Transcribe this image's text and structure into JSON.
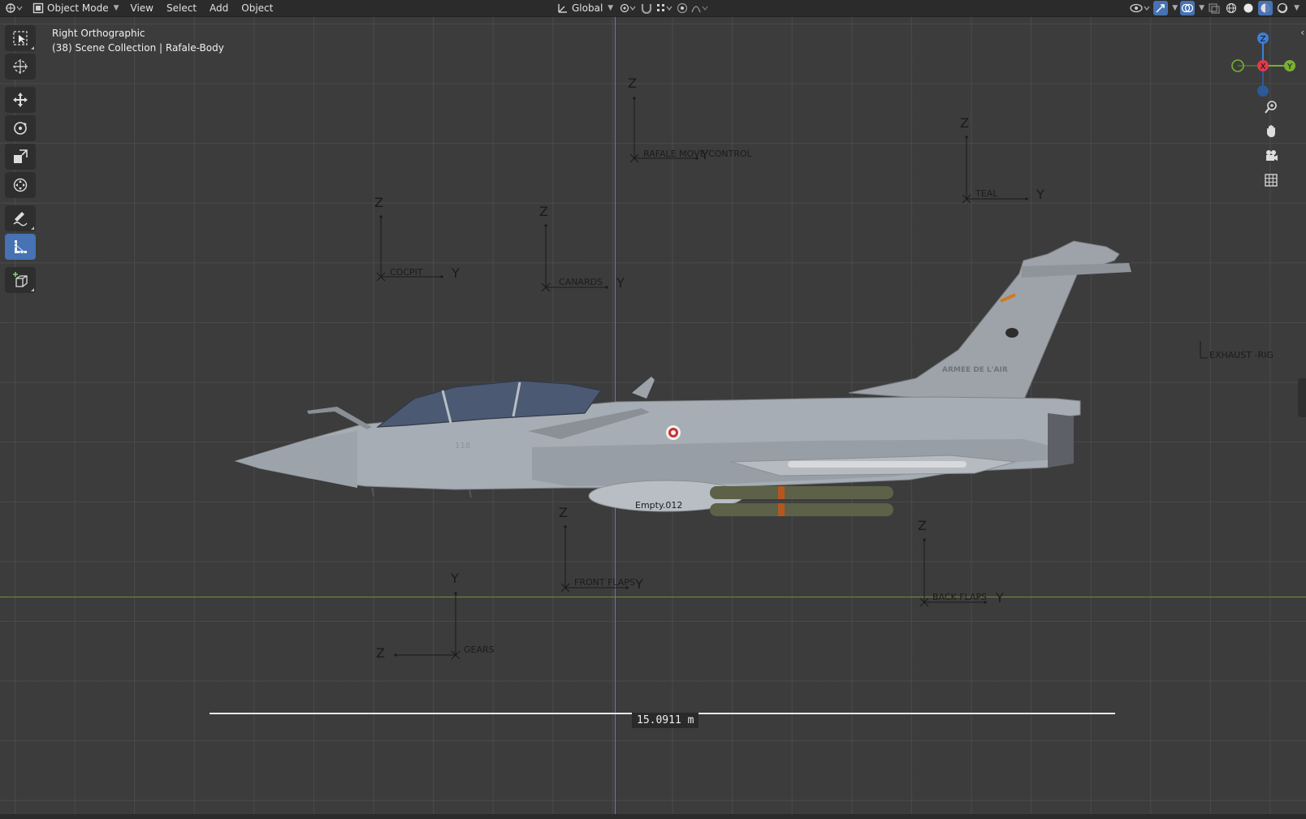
{
  "header": {
    "mode_label": "Object Mode",
    "menus": [
      "View",
      "Select",
      "Add",
      "Object"
    ],
    "transform_orientation": "Global"
  },
  "viewport": {
    "view_name": "Right Orthographic",
    "collection_info": "(38) Scene Collection | Rafale-Body"
  },
  "empties": [
    {
      "label": "RAFALE MOVE CONTROL",
      "z": "Z",
      "y": "Y"
    },
    {
      "label": "TEAL",
      "z": "Z",
      "y": "Y"
    },
    {
      "label": "COCPIT",
      "z": "Z",
      "y": "Y"
    },
    {
      "label": "CANARDS",
      "z": "Z",
      "y": "Y"
    },
    {
      "label": "EXHAUST -RIG"
    },
    {
      "label": "Empty.012"
    },
    {
      "label": "FRONT FLAPS",
      "z": "Z",
      "y": "Y"
    },
    {
      "label": "BACK FLAPS",
      "z": "Z",
      "y": "Y"
    },
    {
      "label": "GEARS",
      "z": "Z",
      "y": "Y"
    }
  ],
  "aircraft": {
    "roundel_text": "ARMEE DE L'AIR",
    "tail_code": "118"
  },
  "measure": {
    "value": "15.0911 m"
  },
  "gizmo": {
    "z": "Z",
    "y": "Y",
    "x": "X"
  },
  "colors": {
    "accent": "#4772b3",
    "axis_x": "#e03a4a",
    "axis_y": "#7ab033",
    "axis_z": "#3f7fd6"
  }
}
